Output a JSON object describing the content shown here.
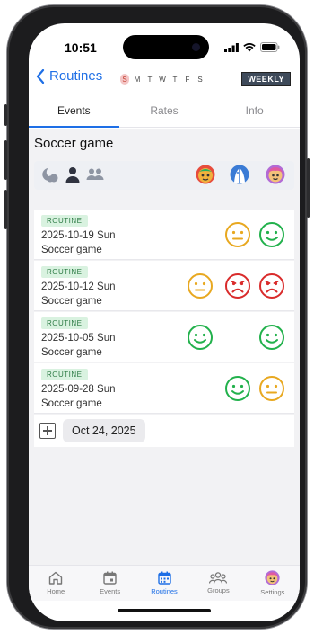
{
  "status_bar": {
    "time": "10:51"
  },
  "nav": {
    "back_label": "Routines",
    "days": [
      "S",
      "M",
      "T",
      "W",
      "T",
      "F",
      "S"
    ],
    "weekly_label": "WEEKLY"
  },
  "tabs": [
    {
      "label": "Events",
      "active": true
    },
    {
      "label": "Rates",
      "active": false
    },
    {
      "label": "Info",
      "active": false
    }
  ],
  "page_title": "Soccer game",
  "header_icons": [
    "moon-icon",
    "person-icon",
    "group-icon",
    "avatar-1-icon",
    "avatar-2-icon",
    "avatar-3-icon"
  ],
  "events": [
    {
      "badge": "ROUTINE",
      "date": "2025-10-19 Sun",
      "name": "Soccer game",
      "faces": [
        "",
        "neutral-yellow",
        "happy-green"
      ]
    },
    {
      "badge": "ROUTINE",
      "date": "2025-10-12 Sun",
      "name": "Soccer game",
      "faces": [
        "neutral-yellow",
        "sad-red",
        "sad-red"
      ]
    },
    {
      "badge": "ROUTINE",
      "date": "2025-10-05 Sun",
      "name": "Soccer game",
      "faces": [
        "happy-green",
        "",
        "happy-green"
      ]
    },
    {
      "badge": "ROUTINE",
      "date": "2025-09-28 Sun",
      "name": "Soccer game",
      "faces": [
        "",
        "happy-green",
        "neutral-yellow"
      ]
    }
  ],
  "add_row": {
    "date": "Oct 24, 2025"
  },
  "bottom_nav": [
    {
      "label": "Home",
      "icon": "home-icon"
    },
    {
      "label": "Events",
      "icon": "calendar-icon"
    },
    {
      "label": "Routines",
      "icon": "calendar-grid-icon",
      "active": true
    },
    {
      "label": "Groups",
      "icon": "groups-icon"
    },
    {
      "label": "Settings",
      "icon": "avatar-settings-icon"
    }
  ],
  "colors": {
    "accent": "#1e6fe6",
    "happy": "#22b14c",
    "neutral": "#e8a820",
    "sad": "#d92b2b",
    "badge_bg": "#d9f2e0"
  }
}
